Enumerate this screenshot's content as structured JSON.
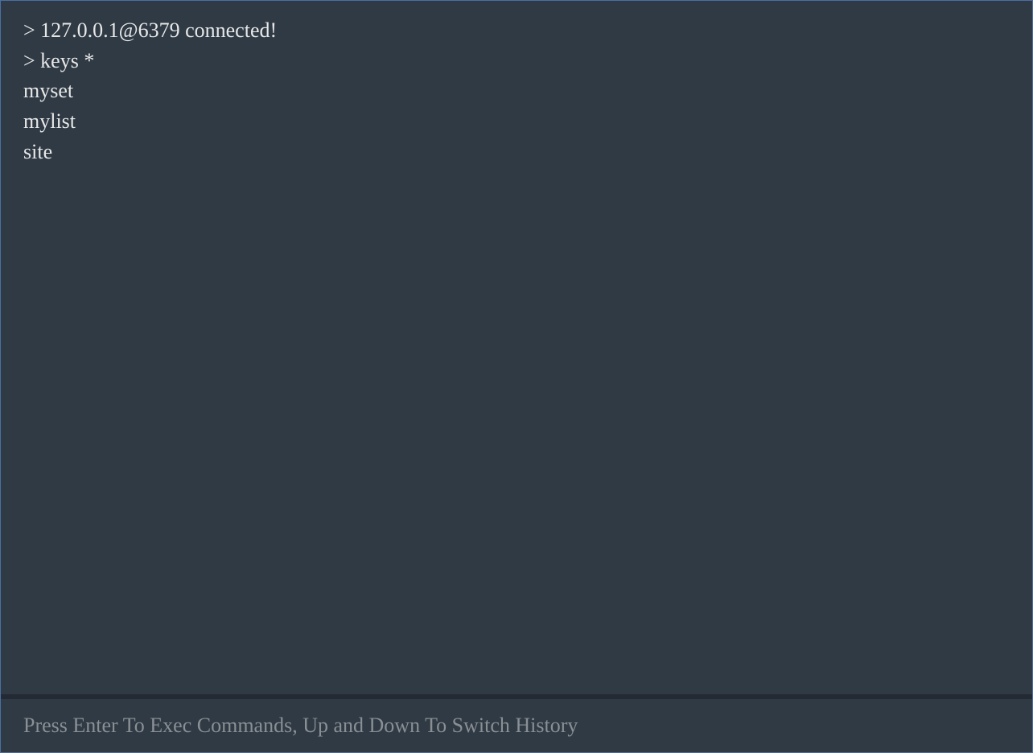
{
  "terminal": {
    "lines": [
      "> 127.0.0.1@6379 connected!",
      "> keys *",
      "myset",
      "mylist",
      "site"
    ],
    "input": {
      "placeholder": "Press Enter To Exec Commands, Up and Down To Switch History",
      "value": ""
    }
  }
}
